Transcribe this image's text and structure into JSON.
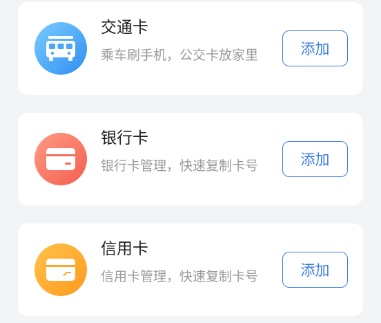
{
  "cards": [
    {
      "title": "交通卡",
      "description": "乘车刷手机，公交卡放家里",
      "button_label": "添加",
      "icon": "bus-icon",
      "icon_color": "#3a9cf5"
    },
    {
      "title": "银行卡",
      "description": "银行卡管理，快速复制卡号",
      "button_label": "添加",
      "icon": "bank-card-icon",
      "icon_color": "#f76c5c"
    },
    {
      "title": "信用卡",
      "description": "信用卡管理，快速复制卡号",
      "button_label": "添加",
      "icon": "credit-card-icon",
      "icon_color": "#ffa726"
    }
  ],
  "colors": {
    "accent": "#3b7bea",
    "background": "#f3f4f6",
    "card": "#ffffff",
    "title_text": "#1f1f1f",
    "secondary_text": "#9a9a9a"
  }
}
